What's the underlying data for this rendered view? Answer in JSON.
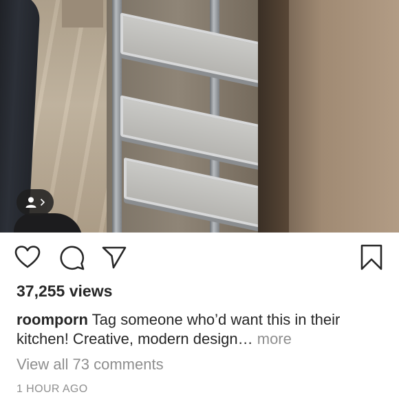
{
  "media": {
    "tag_icon": "person-icon",
    "tag_arrow_icon": "chevron-right-icon"
  },
  "actions": {
    "like_icon": "heart-icon",
    "comment_icon": "comment-icon",
    "share_icon": "paper-plane-icon",
    "save_icon": "bookmark-icon"
  },
  "post": {
    "views": "37,255 views",
    "username": "roomporn",
    "caption": "Tag someone who’d want this in their kitchen! Creative, modern design…",
    "more_label": "more",
    "view_comments": "View all 73 comments",
    "timestamp": "1 HOUR AGO"
  }
}
